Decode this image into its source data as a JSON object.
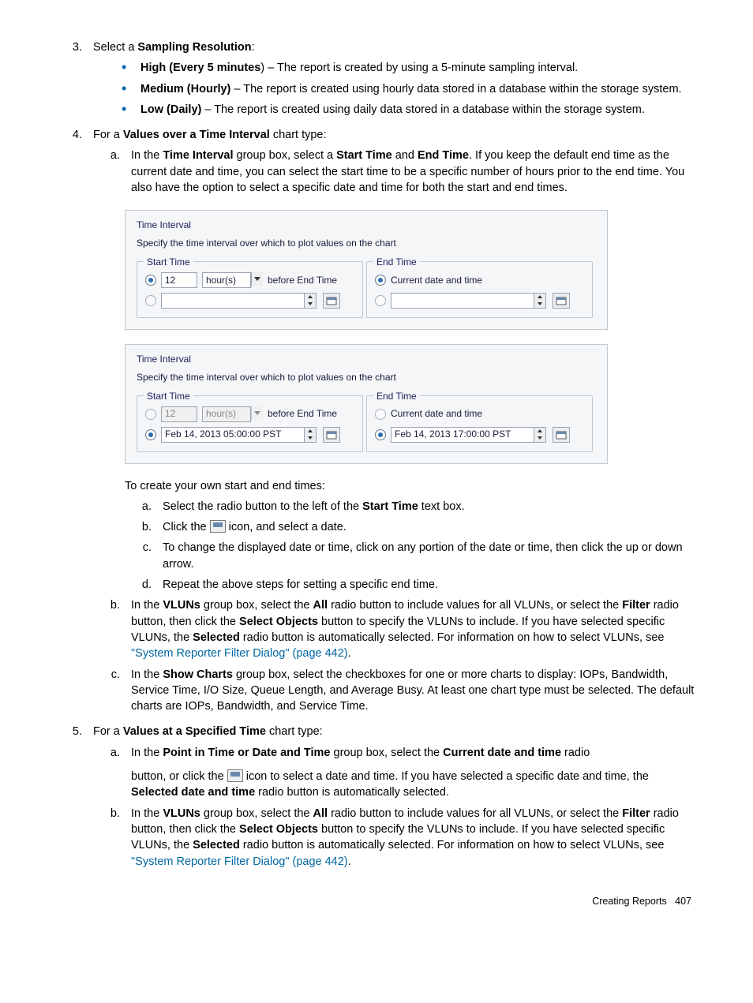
{
  "step3": {
    "num": "3.",
    "lead1": "Select a ",
    "b1": "Sampling Resolution",
    "tail": ":",
    "items": [
      {
        "b": "High (Every 5 minutes",
        "paren": ")",
        "rest": " – The report is created by using a 5-minute sampling interval."
      },
      {
        "b": "Medium (Hourly)",
        "rest": " – The report is created using hourly data stored in a database within the storage system."
      },
      {
        "b": "Low (Daily)",
        "rest": " – The report is created using daily data stored in a database within the storage system."
      }
    ]
  },
  "step4": {
    "num": "4.",
    "lead1": "For a ",
    "b1": "Values over a Time Interval",
    "tail": " chart type:",
    "a": {
      "num": "a.",
      "parts": [
        "In the ",
        "Time Interval",
        " group box, select a ",
        "Start Time",
        " and ",
        "End Time",
        ". If you keep the default end time as the current date and time, you can select the start time to be a specific number of hours prior to the end time. You also have the option to select a specific date and time for both the start and end times."
      ]
    }
  },
  "shot1": {
    "title": "Time Interval",
    "desc": "Specify the time interval over which to plot values on the chart",
    "start": "Start Time",
    "end": "End Time",
    "num": "12",
    "unit": "hour(s)",
    "before": "before End Time",
    "cur": "Current date and time"
  },
  "shot2": {
    "title": "Time Interval",
    "desc": "Specify the time interval over which to plot values on the chart",
    "start": "Start Time",
    "end": "End Time",
    "num": "12",
    "unit": "hour(s)",
    "before": "before End Time",
    "cur": "Current date and time",
    "d1": "Feb 14, 2013 05:00:00 PST",
    "d2": "Feb 14, 2013 17:00:00 PST"
  },
  "own": {
    "intro": "To create your own start and end times:",
    "a": {
      "num": "a.",
      "t1": "Select the radio button to the left of the ",
      "b": "Start Time",
      "t2": " text box."
    },
    "b": {
      "num": "b.",
      "t1": "Click the ",
      "t2": " icon, and select a date."
    },
    "c": {
      "num": "c.",
      "t": "To change the displayed date or time, click on any portion of the date or time, then click the up or down arrow."
    },
    "d": {
      "num": "d.",
      "t": "Repeat the above steps for setting a specific end time."
    }
  },
  "four_b": {
    "num": "b.",
    "parts": [
      "In the ",
      "VLUNs",
      " group box, select the ",
      "All",
      " radio button to include values for all VLUNs, or select the ",
      "Filter",
      " radio button, then click the ",
      "Select Objects ",
      " button to specify the VLUNs to include. If you have selected specific VLUNs, the ",
      "Selected",
      " radio button is automatically selected. For information on how to select VLUNs, see "
    ],
    "link": "\"System Reporter Filter Dialog\" (page 442)",
    "dot": "."
  },
  "four_c": {
    "num": "c.",
    "parts": [
      "In the ",
      "Show Charts",
      " group box, select the checkboxes for one or more charts to display: IOPs, Bandwidth, Service Time, I/O Size, Queue Length, and Average Busy. At least one chart type must be selected. The default charts are IOPs, Bandwidth, and Service Time."
    ]
  },
  "step5": {
    "num": "5.",
    "lead1": "For a ",
    "b1": "Values at a Specified Time",
    "tail": " chart type:",
    "a": {
      "num": "a.",
      "p1": [
        "In the ",
        "Point in Time or Date and Time",
        " group box, select the ",
        "Current date and time",
        " radio"
      ],
      "p2a": "button, or click the ",
      "p2b": " icon to select a date and time. If you have selected a specific date and time, the ",
      "b2": "Selected date and time",
      "p2c": " radio button is automatically selected."
    },
    "b": {
      "num": "b.",
      "parts": [
        "In the ",
        "VLUNs",
        " group box, select the ",
        "All",
        " radio button to include values for all VLUNs, or select the ",
        "Filter",
        " radio button, then click the ",
        "Select Objects ",
        " button to specify the VLUNs to include. If you have selected specific VLUNs, the ",
        "Selected",
        " radio button is automatically selected. For information on how to select VLUNs, see "
      ],
      "link": "\"System Reporter Filter Dialog\" (page 442)",
      "dot": "."
    }
  },
  "footer": {
    "label": "Creating Reports",
    "page": "407"
  }
}
